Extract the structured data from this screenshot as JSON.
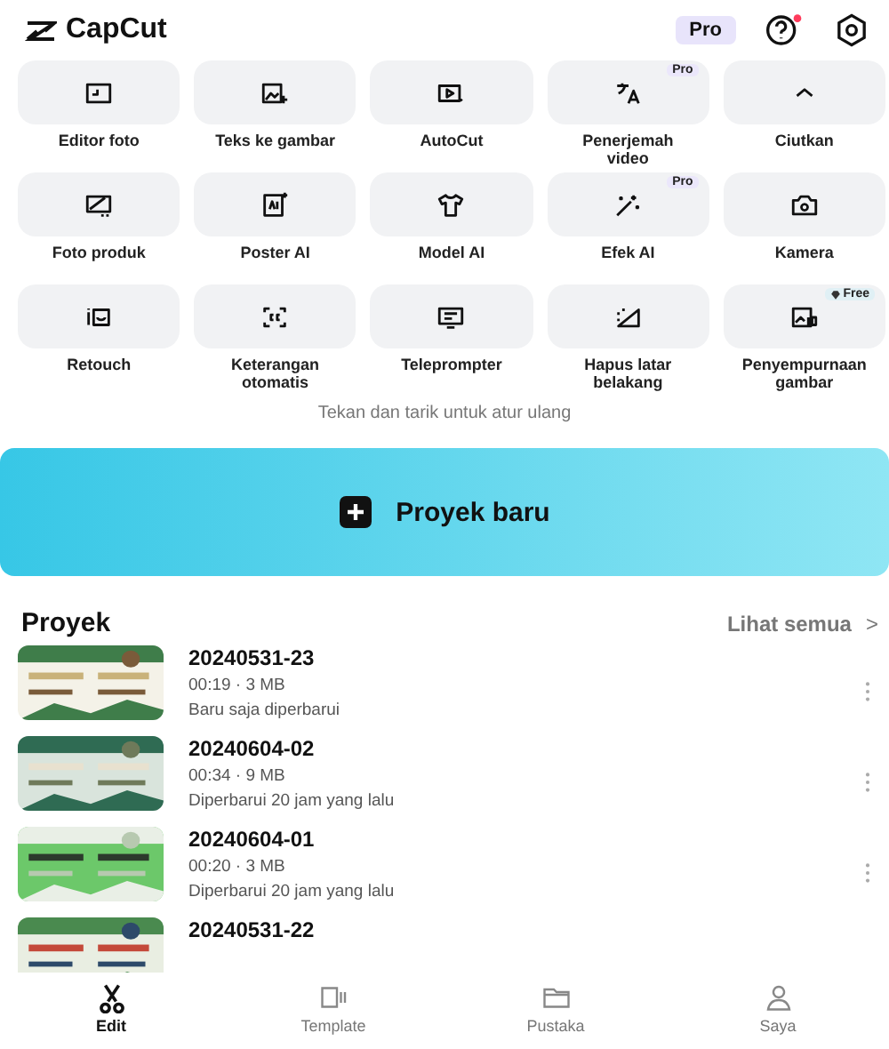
{
  "app": {
    "name": "CapCut",
    "pro_badge": "Pro",
    "notification_dot": true
  },
  "tools": [
    {
      "label": "Editor foto"
    },
    {
      "label": "Teks ke gambar"
    },
    {
      "label": "AutoCut"
    },
    {
      "label": "Penerjemah video",
      "badge": "Pro"
    },
    {
      "label": "Ciutkan"
    },
    {
      "label": "Foto produk"
    },
    {
      "label": "Poster AI"
    },
    {
      "label": "Model AI"
    },
    {
      "label": "Efek AI",
      "badge": "Pro"
    },
    {
      "label": "Kamera"
    },
    {
      "label": "Retouch"
    },
    {
      "label": "Keterangan otomatis"
    },
    {
      "label": "Teleprompter"
    },
    {
      "label": "Hapus latar belakang"
    },
    {
      "label": "Penyempurnaan gambar",
      "badge": "Free",
      "badge_icon": true
    }
  ],
  "hint": "Tekan dan tarik untuk atur ulang",
  "new_project": "Proyek baru",
  "projects_title": "Proyek",
  "see_all": "Lihat semua",
  "see_all_arrow": ">",
  "projects": [
    {
      "name": "20240531-23",
      "meta": "00:19 · 3 MB",
      "updated": "Baru saja diperbarui"
    },
    {
      "name": "20240604-02",
      "meta": "00:34 · 9 MB",
      "updated": "Diperbarui 20 jam yang lalu"
    },
    {
      "name": "20240604-01",
      "meta": "00:20 · 3 MB",
      "updated": "Diperbarui 20 jam yang lalu"
    },
    {
      "name": "20240531-22"
    }
  ],
  "nav": [
    {
      "label": "Edit",
      "selected": true
    },
    {
      "label": "Template",
      "selected": false
    },
    {
      "label": "Pustaka",
      "selected": false
    },
    {
      "label": "Saya",
      "selected": false
    }
  ]
}
